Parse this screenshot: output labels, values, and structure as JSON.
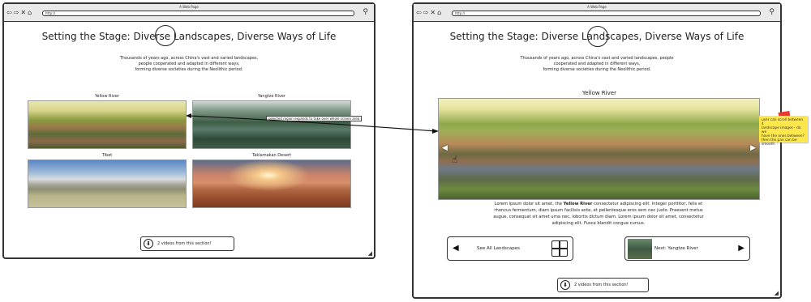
{
  "left": {
    "window_title": "A Web Page",
    "url": "http://",
    "heading": "Setting the Stage: Diverse Landscapes, Diverse Ways of Life",
    "intro": [
      "Thousands of years ago, across China's vast and varied landscapes,",
      "people cooperated and adapted in different ways,",
      "forming diverse societies during the Neolithic period."
    ],
    "tiles": [
      {
        "label": "Yellow River"
      },
      {
        "label": "Yangtze River"
      },
      {
        "label": "Tibet"
      },
      {
        "label": "Taklamakan Desert"
      }
    ],
    "tooltip": "selected region expands to take over whole screen area",
    "videos_label": "2 videos from this section!"
  },
  "right": {
    "window_title": "A Web Page",
    "url": "http://",
    "heading": "Setting the Stage: Diverse Landscapes, Diverse Ways of Life",
    "intro": [
      "Thousands of years ago, across China's vast and varied landscapes, people",
      "cooperated and adapted in different ways,",
      "forming diverse societies during the Neolithic period."
    ],
    "region_title": "Yellow River",
    "lorem": {
      "l1a": "Lorem ipsum dolor sit amet, the ",
      "l1b": "Yellow River",
      "l1c": " consectetur adipiscing elit. Integer porttitor, felis et",
      "l2": "rhoncus fermentum, diam ipsum facilisis ante, et pellentesque eros sem nec justo. Praesent metus",
      "l3": "augue, consequat sit amet urna nec, lobortis dictum diam. Lorem ipsum dolor sit amet, consectetur",
      "l4": "adipiscing elit. Fusce blandit congue cursus."
    },
    "see_all_label": "See All Landscapes",
    "next_label": "Next: Yangtze River",
    "videos_label": "2 videos from this section!"
  },
  "sticky_note": {
    "lines": [
      "user can scroll between 4",
      "landscape images - do we",
      "have the ones between?",
      "then the pan can be smooth"
    ]
  }
}
